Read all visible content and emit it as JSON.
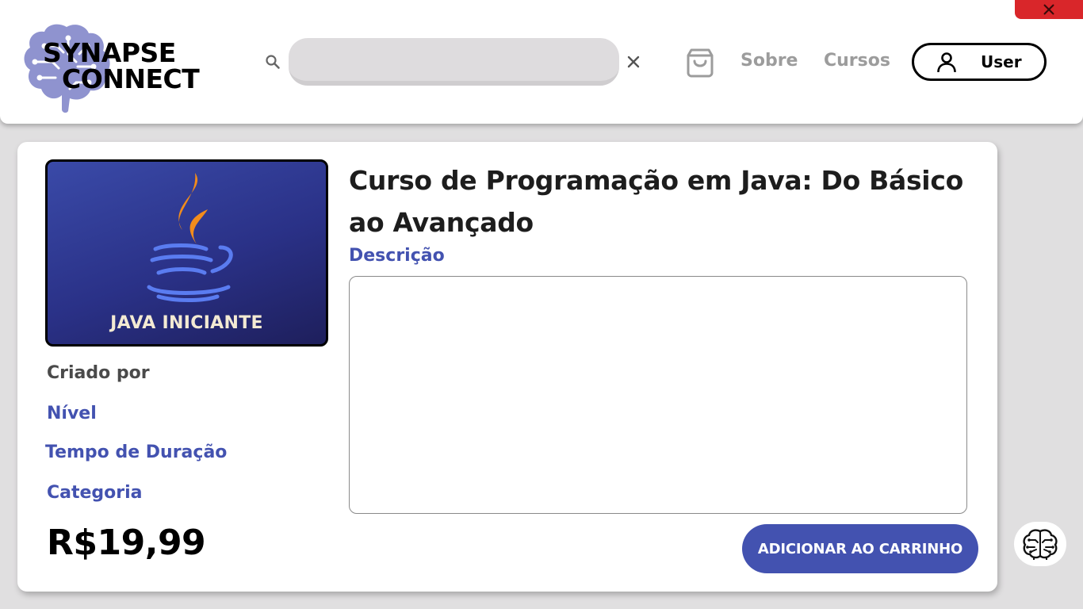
{
  "header": {
    "logo": {
      "line1": "SYNAPSE",
      "line2": "CONNECT",
      "icon": "brain-circuit-icon"
    },
    "search": {
      "value": "",
      "placeholder": "",
      "icon": "search-icon",
      "clear_icon": "close-icon"
    },
    "cart_icon": "shopping-bag-icon",
    "nav": {
      "sobre": "Sobre",
      "cursos": "Cursos"
    },
    "user": {
      "label": "User",
      "icon": "user-icon"
    },
    "window_close_icon": "close-icon"
  },
  "course": {
    "thumbnail": {
      "label": "JAVA INICIANTE",
      "icon": "java-coffee-cup-icon"
    },
    "title": "Curso de Programação em Java: Do Básico ao Avançado",
    "description_label": "Descrição",
    "description_value": "",
    "creator_label": "Criado por",
    "level_label": "Nível",
    "duration_label": "Tempo de Duração",
    "category_label": "Categoria",
    "price": "R$19,99",
    "add_to_cart": "ADICIONAR AO CARRINHO"
  },
  "chat": {
    "icon": "brain-chip-icon"
  },
  "colors": {
    "accent": "#4352b0",
    "close_red": "#d9262a",
    "background": "#e0dfe0",
    "nav_gray": "#9c9c9c"
  }
}
